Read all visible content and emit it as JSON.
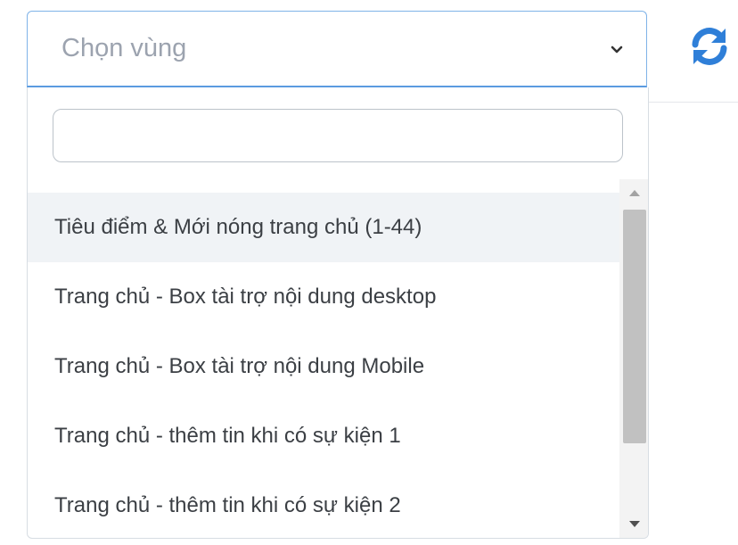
{
  "select": {
    "placeholder": "Chọn vùng"
  },
  "search": {
    "value": "",
    "placeholder": ""
  },
  "options": [
    "Tiêu điểm & Mới nóng trang chủ (1-44)",
    "Trang chủ - Box tài trợ nội dung desktop",
    "Trang chủ - Box tài trợ nội dung Mobile",
    "Trang chủ - thêm tin khi có sự kiện 1",
    "Trang chủ - thêm tin khi có sự kiện 2"
  ],
  "highlighted_option_index": 0,
  "icons": {
    "dropdown": "chevron-down-icon",
    "refresh": "refresh-icon"
  },
  "colors": {
    "accent": "#2f7fd8",
    "select_border": "#7fb3e8",
    "highlight_bg": "#f0f3f6",
    "text": "#3b3f44",
    "placeholder": "#9ca3af"
  }
}
